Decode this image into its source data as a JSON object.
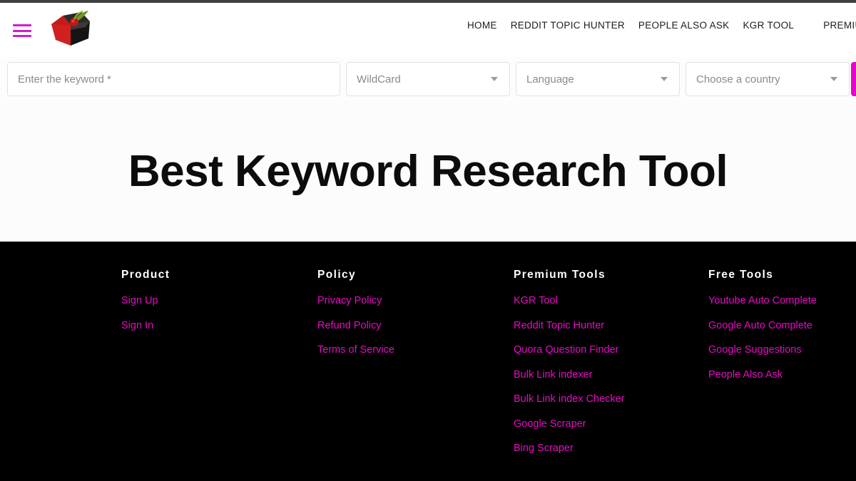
{
  "header": {
    "menu_icon": "hamburger-menu-icon",
    "logo_alt": "3d-cube-logo",
    "nav": [
      {
        "label": "HOME"
      },
      {
        "label": "REDDIT TOPIC HUNTER"
      },
      {
        "label": "PEOPLE ALSO ASK"
      },
      {
        "label": "KGR TOOL"
      },
      {
        "label": "PREMIUM TOO"
      }
    ]
  },
  "search": {
    "keyword_placeholder": "Enter the keyword *",
    "wildcard_label": "WildCard",
    "language_label": "Language",
    "country_label": "Choose a country",
    "caret_icon": "chevron-down-icon",
    "submit_color": "#e606c9"
  },
  "hero": {
    "title": "Best Keyword Research Tool"
  },
  "footer": {
    "link_color": "#e60cc4",
    "columns": [
      {
        "heading": "Product",
        "links": [
          {
            "label": "Sign Up"
          },
          {
            "label": "Sign In"
          }
        ]
      },
      {
        "heading": "Policy",
        "links": [
          {
            "label": "Privacy Policy"
          },
          {
            "label": "Refund Policy"
          },
          {
            "label": "Terms of Service"
          }
        ]
      },
      {
        "heading": "Premium Tools",
        "links": [
          {
            "label": "KGR Tool"
          },
          {
            "label": "Reddit Topic Hunter"
          },
          {
            "label": "Quora Question Finder"
          },
          {
            "label": "Bulk Link indexer"
          },
          {
            "label": "Bulk Link index Checker"
          },
          {
            "label": "Google Scraper"
          },
          {
            "label": "Bing Scraper"
          }
        ]
      },
      {
        "heading": "Free Tools",
        "links": [
          {
            "label": "Youtube Auto Complete"
          },
          {
            "label": "Google Auto Complete"
          },
          {
            "label": "Google Suggestions"
          },
          {
            "label": "People Also Ask"
          }
        ]
      }
    ]
  }
}
